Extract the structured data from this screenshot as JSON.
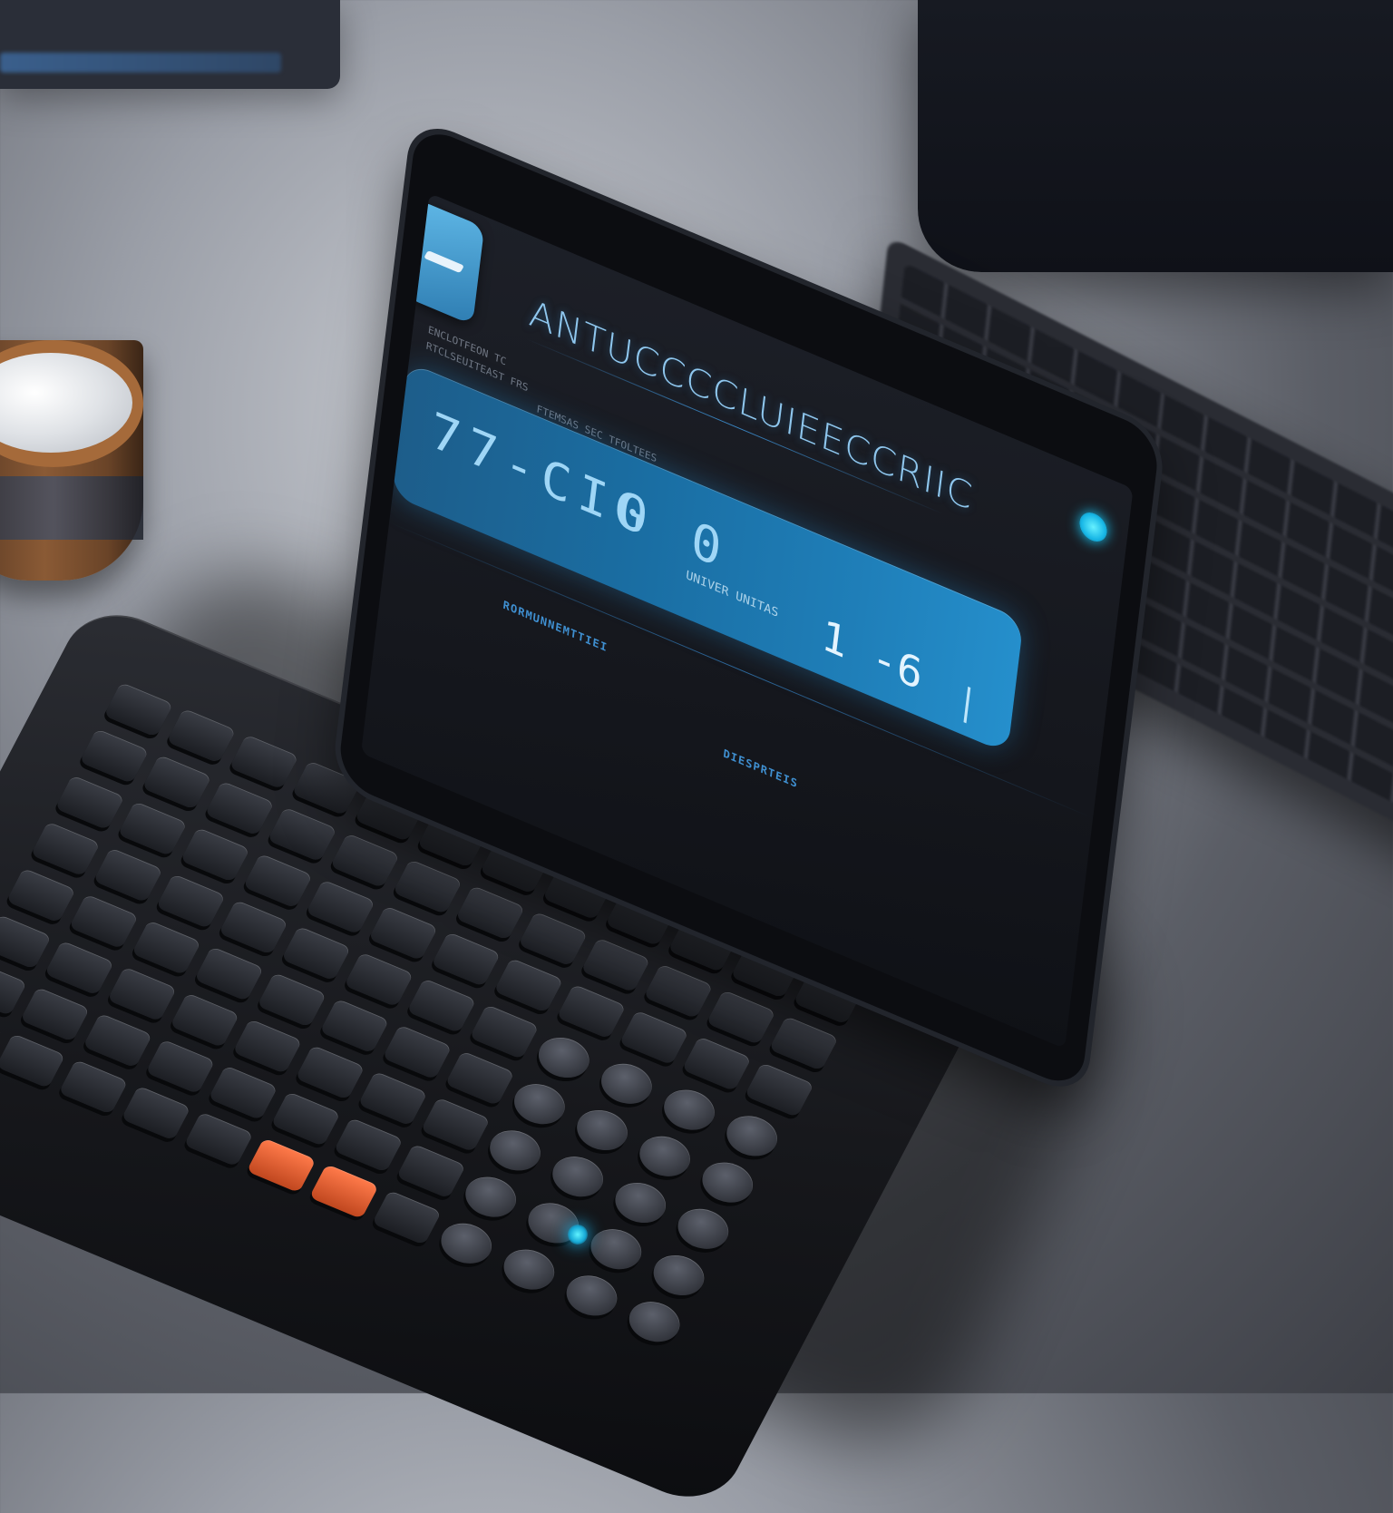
{
  "screen": {
    "title": "ANTUCCCCLUIEECCRIIC",
    "display_value": "77-CIG",
    "display_ops": "0  0",
    "display_sub": "UNIVER  UNITAS",
    "display_result": "1 -6",
    "fine_text_1": "ENCLOTFEON  TC",
    "fine_text_2": "RTCLSEUITEAST FRS",
    "fine_text_3": "FTEMSAS  SEC TFOLTEES",
    "footer_label_1": "RORMUNNEMTTIEI",
    "footer_label_2": "DIESPRTEIS"
  },
  "colors": {
    "accent": "#1f7fb9",
    "glow": "#1ad0ff",
    "orange_key": "#e0602f"
  },
  "icons": {
    "app": "calculator-app-icon",
    "status": "status-led-icon"
  }
}
